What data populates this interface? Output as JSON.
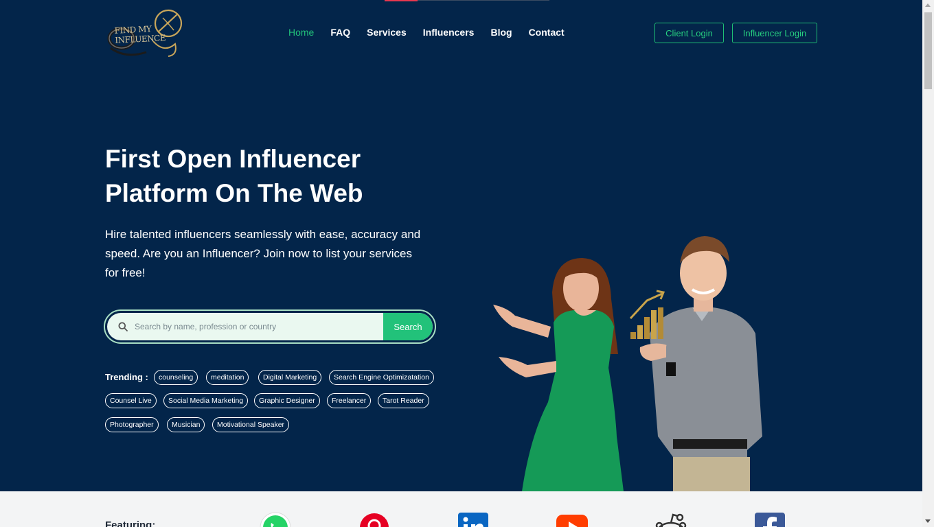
{
  "brand": {
    "logo_line1": "FIND MY",
    "logo_line2": "INFLUENCE"
  },
  "nav": {
    "items": [
      {
        "label": "Home",
        "active": true
      },
      {
        "label": "FAQ",
        "active": false
      },
      {
        "label": "Services",
        "active": false
      },
      {
        "label": "Influencers",
        "active": false
      },
      {
        "label": "Blog",
        "active": false
      },
      {
        "label": "Contact",
        "active": false
      }
    ],
    "client_login": "Client Login",
    "influencer_login": "Influencer Login"
  },
  "hero": {
    "title_line1": "First Open Influencer",
    "title_line2": "Platform On The Web",
    "subtitle": "Hire talented influencers seamlessly with ease, accuracy and speed. Are you an Influencer? Join now to list your services for free!"
  },
  "search": {
    "placeholder": "Search by name, profession or country",
    "button": "Search"
  },
  "trending": {
    "label": "Trending :",
    "tags": [
      "counseling",
      "meditation",
      "Digital Marketing",
      "Search Engine Optimizatation",
      "Counsel Live",
      "Social Media Marketing",
      "Graphic Designer",
      "Freelancer",
      "Tarot Reader",
      "Photographer",
      "Musician",
      "Motivational Speaker"
    ]
  },
  "featuring": {
    "label": "Featuring:",
    "icons": [
      "whatsapp-icon",
      "pinterest-icon",
      "linkedin-icon",
      "youtube-icon",
      "reddit-icon",
      "facebook-icon"
    ]
  },
  "colors": {
    "hero_bg": "#03254a",
    "accent": "#22c27a",
    "nav_accent_line": "#e8384f"
  }
}
